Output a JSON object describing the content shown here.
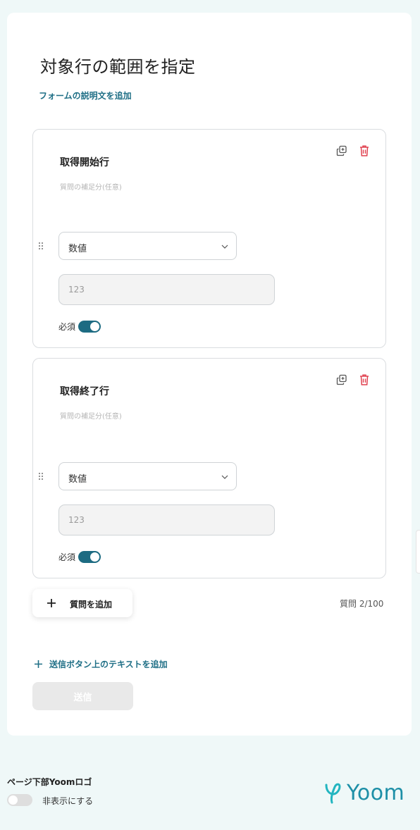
{
  "form": {
    "title": "対象行の範囲を指定",
    "add_description_link": "フォームの説明文を追加"
  },
  "questions": [
    {
      "title": "取得開始行",
      "help_placeholder": "質問の補足分(任意)",
      "type_value": "数値",
      "input_placeholder": "123",
      "required_label": "必須",
      "required": true
    },
    {
      "title": "取得終了行",
      "help_placeholder": "質問の補足分(任意)",
      "type_value": "数値",
      "input_placeholder": "123",
      "required_label": "必須",
      "required": true
    }
  ],
  "add_question": {
    "label": "質問を追加",
    "count": "質問 2/100"
  },
  "submit": {
    "add_text_link": "送信ボタン上のテキストを追加",
    "button_label": "送信"
  },
  "footer": {
    "logo_setting_label": "ページ下部Yoomロゴ",
    "hide_toggle_label": "非表示にする",
    "hide_logo": false,
    "brand_name": "Yoom"
  },
  "colors": {
    "background": "#eff8f8",
    "accent": "#1d6b82",
    "link": "#1f6f86",
    "delete": "#e0414f",
    "brand": "#1d8fa7"
  },
  "icons": [
    "copy-icon",
    "trash-icon",
    "drag-handle-icon",
    "chevron-down-icon",
    "plus-icon"
  ]
}
